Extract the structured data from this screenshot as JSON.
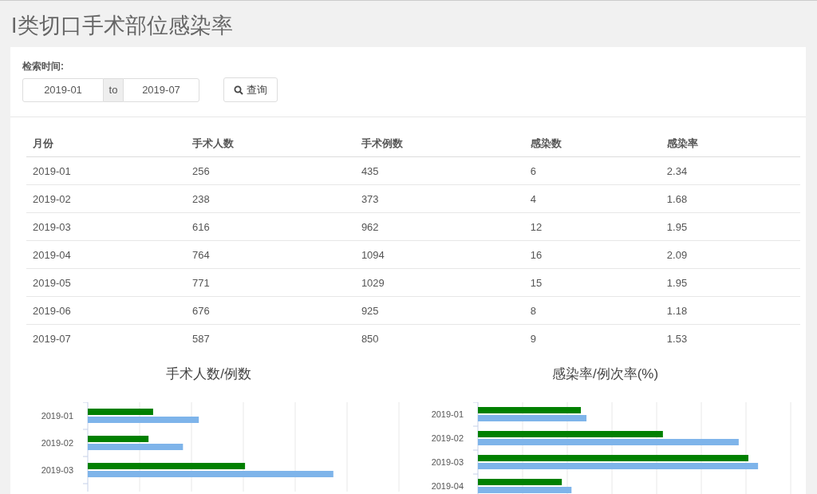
{
  "page_title": "I类切口手术部位感染率",
  "search": {
    "label": "检索时间:",
    "from": "2019-01",
    "separator": "to",
    "to": "2019-07",
    "button": "查询"
  },
  "table": {
    "columns": [
      "月份",
      "手术人数",
      "手术例数",
      "感染数",
      "感染率"
    ],
    "rows": [
      [
        "2019-01",
        "256",
        "435",
        "6",
        "2.34"
      ],
      [
        "2019-02",
        "238",
        "373",
        "4",
        "1.68"
      ],
      [
        "2019-03",
        "616",
        "962",
        "12",
        "1.95"
      ],
      [
        "2019-04",
        "764",
        "1094",
        "16",
        "2.09"
      ],
      [
        "2019-05",
        "771",
        "1029",
        "15",
        "1.95"
      ],
      [
        "2019-06",
        "676",
        "925",
        "8",
        "1.18"
      ],
      [
        "2019-07",
        "587",
        "850",
        "9",
        "1.53"
      ]
    ]
  },
  "charts": [
    {
      "title": "手术人数/例数",
      "categories": [
        "2019-01",
        "2019-02",
        "2019-03"
      ]
    },
    {
      "title": "感染率/例次率(%)",
      "categories": [
        "2019-01",
        "2019-02",
        "2019-03",
        "2019-04"
      ]
    }
  ]
}
